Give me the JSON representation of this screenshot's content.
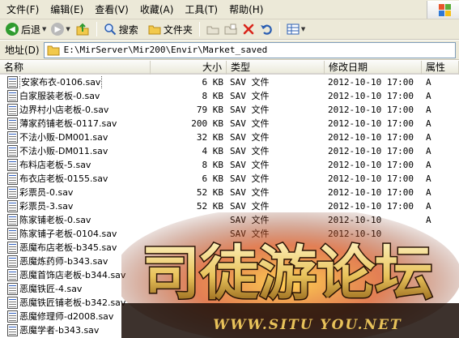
{
  "menubar": {
    "items": [
      "文件(F)",
      "编辑(E)",
      "查看(V)",
      "收藏(A)",
      "工具(T)",
      "帮助(H)"
    ]
  },
  "toolbar": {
    "back_label": "后退",
    "search_label": "搜索",
    "folders_label": "文件夹"
  },
  "address": {
    "label": "地址(D)",
    "path": "E:\\MirServer\\Mir200\\Envir\\Market_saved"
  },
  "columns": {
    "name": "名称",
    "size": "大小",
    "type": "类型",
    "date": "修改日期",
    "attr": "属性"
  },
  "files": [
    {
      "name": "安家布衣-0106.sav",
      "size": "6 KB",
      "type": "SAV 文件",
      "date": "2012-10-10 17:00",
      "attr": "A"
    },
    {
      "name": "白家服装老板-0.sav",
      "size": "8 KB",
      "type": "SAV 文件",
      "date": "2012-10-10 17:00",
      "attr": "A"
    },
    {
      "name": "边界村小店老板-0.sav",
      "size": "79 KB",
      "type": "SAV 文件",
      "date": "2012-10-10 17:00",
      "attr": "A"
    },
    {
      "name": "薄家药铺老板-0117.sav",
      "size": "200 KB",
      "type": "SAV 文件",
      "date": "2012-10-10 17:00",
      "attr": "A"
    },
    {
      "name": "不法小贩-DM001.sav",
      "size": "32 KB",
      "type": "SAV 文件",
      "date": "2012-10-10 17:00",
      "attr": "A"
    },
    {
      "name": "不法小贩-DM011.sav",
      "size": "4 KB",
      "type": "SAV 文件",
      "date": "2012-10-10 17:00",
      "attr": "A"
    },
    {
      "name": "布料店老板-5.sav",
      "size": "8 KB",
      "type": "SAV 文件",
      "date": "2012-10-10 17:00",
      "attr": "A"
    },
    {
      "name": "布衣店老板-0155.sav",
      "size": "6 KB",
      "type": "SAV 文件",
      "date": "2012-10-10 17:00",
      "attr": "A"
    },
    {
      "name": "彩票员-0.sav",
      "size": "52 KB",
      "type": "SAV 文件",
      "date": "2012-10-10 17:00",
      "attr": "A"
    },
    {
      "name": "彩票员-3.sav",
      "size": "52 KB",
      "type": "SAV 文件",
      "date": "2012-10-10 17:00",
      "attr": "A"
    },
    {
      "name": "陈家铺老板-0.sav",
      "size": "",
      "type": "SAV 文件",
      "date": "2012-10-10",
      "attr": "A"
    },
    {
      "name": "陈家铺子老板-0104.sav",
      "size": "",
      "type": "SAV 文件",
      "date": "2012-10-10",
      "attr": ""
    },
    {
      "name": "恶魔布店老板-b345.sav",
      "size": "",
      "type": "",
      "date": "",
      "attr": ""
    },
    {
      "name": "恶魔炼药师-b343.sav",
      "size": "",
      "type": "",
      "date": "",
      "attr": ""
    },
    {
      "name": "恶魔首饰店老板-b344.sav",
      "size": "",
      "type": "",
      "date": "",
      "attr": ""
    },
    {
      "name": "恶魔铁匠-4.sav",
      "size": "",
      "type": "",
      "date": "",
      "attr": ""
    },
    {
      "name": "恶魔铁匠铺老板-b342.sav",
      "size": "",
      "type": "",
      "date": "",
      "attr": ""
    },
    {
      "name": "恶魔修理师-d2008.sav",
      "size": "",
      "type": "",
      "date": "",
      "attr": ""
    },
    {
      "name": "恶魔学者-b343.sav",
      "size": "",
      "type": "",
      "date": "",
      "attr": ""
    }
  ],
  "watermark": {
    "title": "司徒游论坛",
    "url": "WWW.SITU YOU.NET"
  },
  "colors": {
    "chrome": "#ece9d8",
    "back_green": "#2f9b2f",
    "address_border": "#7f9db9",
    "watermark_gold": "#e8c25a"
  }
}
